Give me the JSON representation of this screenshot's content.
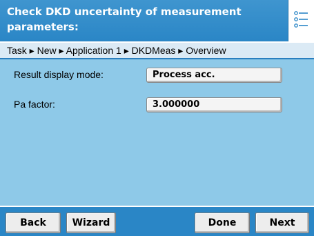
{
  "header": {
    "title": "Check DKD uncertainty of measurement parameters:",
    "menu_icon": "list-menu-icon"
  },
  "breadcrumb": {
    "text": "Task ▸ New ▸ Application 1 ▸ DKDMeas ▸ Overview"
  },
  "params": [
    {
      "label": "Result display mode:",
      "value": "Process acc."
    },
    {
      "label": "Pa factor:",
      "value": "3.000000"
    }
  ],
  "footer": {
    "back": "Back",
    "wizard": "Wizard",
    "done": "Done",
    "next": "Next"
  },
  "colors": {
    "title_bar": "#2a86c6",
    "content_bg": "#8ec9e8",
    "breadcrumb_bg": "#dbeaf5",
    "button_bg": "#ededed"
  }
}
